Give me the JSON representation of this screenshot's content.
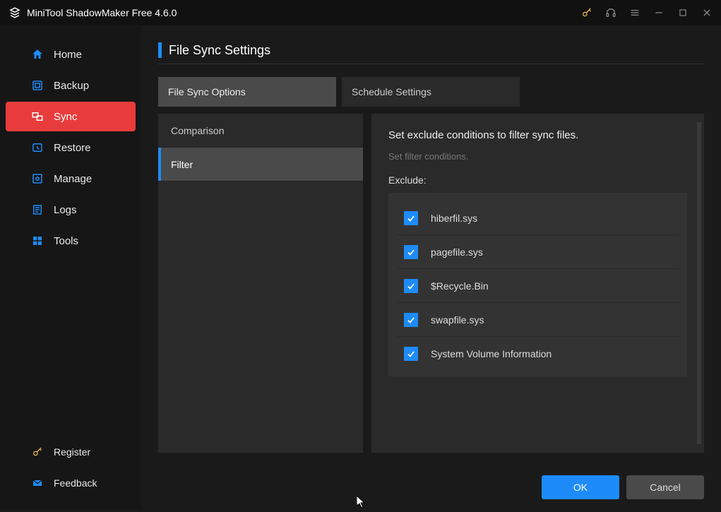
{
  "app": {
    "title": "MiniTool ShadowMaker Free 4.6.0"
  },
  "sidebar": {
    "items": [
      {
        "label": "Home"
      },
      {
        "label": "Backup"
      },
      {
        "label": "Sync"
      },
      {
        "label": "Restore"
      },
      {
        "label": "Manage"
      },
      {
        "label": "Logs"
      },
      {
        "label": "Tools"
      }
    ],
    "bottom": [
      {
        "label": "Register"
      },
      {
        "label": "Feedback"
      }
    ]
  },
  "page": {
    "heading": "File Sync Settings",
    "tabs": [
      {
        "label": "File Sync Options"
      },
      {
        "label": "Schedule Settings"
      }
    ],
    "subnav": [
      {
        "label": "Comparison"
      },
      {
        "label": "Filter"
      }
    ],
    "panel": {
      "headline": "Set exclude conditions to filter sync files.",
      "sub": "Set filter conditions.",
      "exclude_label": "Exclude:",
      "items": [
        {
          "label": "hiberfil.sys",
          "checked": true
        },
        {
          "label": "pagefile.sys",
          "checked": true
        },
        {
          "label": "$Recycle.Bin",
          "checked": true
        },
        {
          "label": "swapfile.sys",
          "checked": true
        },
        {
          "label": "System Volume Information",
          "checked": true
        }
      ]
    },
    "buttons": {
      "ok": "OK",
      "cancel": "Cancel"
    }
  }
}
